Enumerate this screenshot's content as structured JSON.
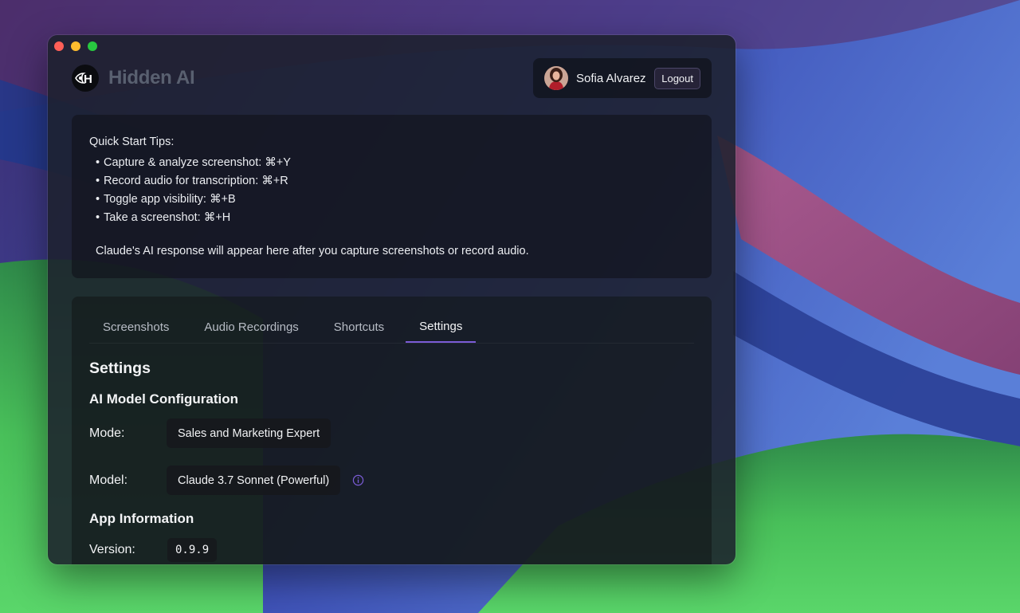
{
  "app": {
    "logo_glyph": "H",
    "name": "Hidden AI"
  },
  "user": {
    "name": "Sofia Alvarez",
    "logout_label": "Logout"
  },
  "tips": {
    "title": "Quick Start Tips:",
    "items": [
      "Capture & analyze screenshot: ⌘+Y",
      "Record audio for transcription: ⌘+R",
      "Toggle app visibility: ⌘+B",
      "Take a screenshot: ⌘+H"
    ],
    "bullet": "•",
    "note": "Claude's AI response will appear here after you capture screenshots or record audio."
  },
  "tabs": [
    {
      "label": "Screenshots",
      "active": false
    },
    {
      "label": "Audio Recordings",
      "active": false
    },
    {
      "label": "Shortcuts",
      "active": false
    },
    {
      "label": "Settings",
      "active": true
    }
  ],
  "settings": {
    "title": "Settings",
    "ai_section_title": "AI Model Configuration",
    "mode_label": "Mode:",
    "mode_value": "Sales and Marketing Expert",
    "model_label": "Model:",
    "model_value": "Claude 3.7 Sonnet (Powerful)",
    "app_info_title": "App Information",
    "version_label": "Version:",
    "version_value": "0.9.9"
  },
  "colors": {
    "accent": "#7b5cd6",
    "traffic_red": "#ff5f57",
    "traffic_yellow": "#febc2e",
    "traffic_green": "#28c840"
  },
  "icons": {
    "info": "info-circle-icon",
    "logo": "eye-logo-icon"
  }
}
